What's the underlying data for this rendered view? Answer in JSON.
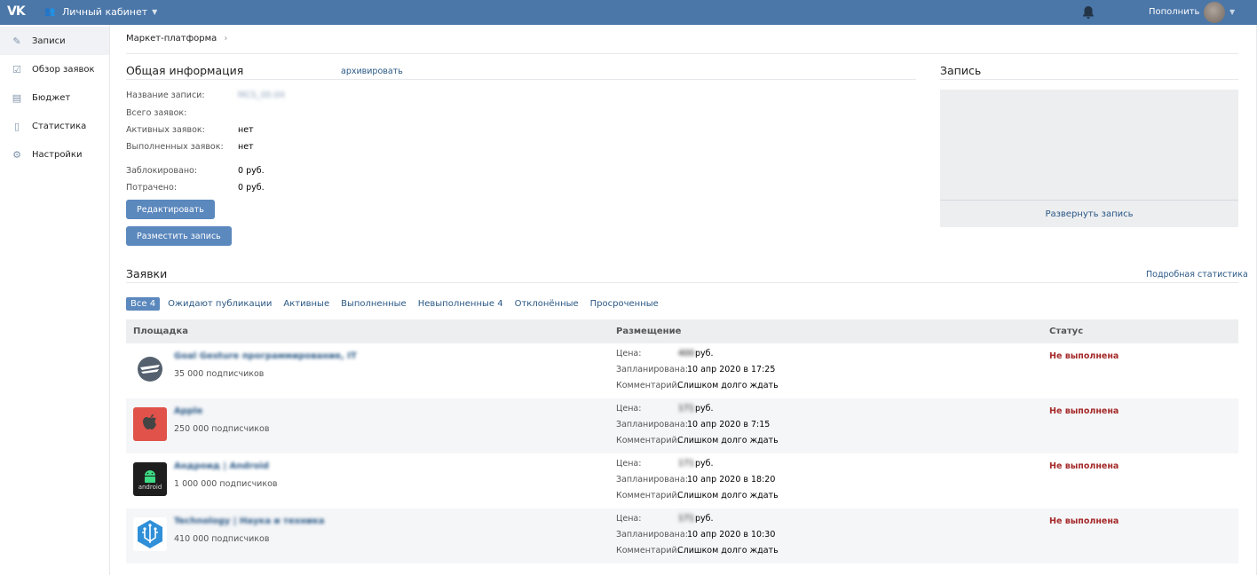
{
  "header": {
    "logo": "VK",
    "cabinet_label": "Личный кабинет",
    "topup_label": "Пополнить"
  },
  "sidebar": {
    "items": [
      {
        "label": "Записи",
        "icon": "megaphone-icon"
      },
      {
        "label": "Обзор заявок",
        "icon": "review-icon"
      },
      {
        "label": "Бюджет",
        "icon": "wallet-icon"
      },
      {
        "label": "Статистика",
        "icon": "stats-icon"
      },
      {
        "label": "Настройки",
        "icon": "gear-icon"
      }
    ]
  },
  "breadcrumb": {
    "label": "Маркет-платформа"
  },
  "general": {
    "title": "Общая информация",
    "archive_link": "архивировать",
    "fields": {
      "name_label": "Название записи:",
      "name_value": "MCS_00.04",
      "total_label": "Всего заявок:",
      "active_label": "Активных заявок:",
      "active_value": "нет",
      "done_label": "Выполненных заявок:",
      "done_value": "нет",
      "blocked_label": "Заблокировано:",
      "blocked_value": "0 руб.",
      "spent_label": "Потрачено:",
      "spent_value": "0 руб."
    },
    "edit_button": "Редактировать",
    "place_button": "Разместить запись"
  },
  "post": {
    "title": "Запись",
    "expand_link": "Развернуть запись"
  },
  "requests": {
    "title": "Заявки",
    "stats_link": "Подробная статистика",
    "tabs": [
      "Все 4",
      "Ожидают публикации",
      "Активные",
      "Выполненные",
      "Невыполненные 4",
      "Отклонённые",
      "Просроченные"
    ],
    "columns": {
      "site": "Площадка",
      "placement": "Размещение",
      "status": "Статус"
    },
    "placement_labels": {
      "price": "Цена:",
      "scheduled": "Запланирована:",
      "comment": "Комментарий:"
    },
    "rows": [
      {
        "name": "Goal Gesture программирование, IT",
        "subscribers": "35 000 подписчиков",
        "price": "400",
        "price_unit": "руб.",
        "scheduled": "10 апр 2020 в 17:25",
        "comment": "Слишком долго ждать",
        "status": "Не выполнена",
        "avatar_color": "#ffffff"
      },
      {
        "name": "Apple",
        "subscribers": "250 000 подписчиков",
        "price": "171",
        "price_unit": "руб.",
        "scheduled": "10 апр 2020 в 7:15",
        "comment": "Слишком долго ждать",
        "status": "Не выполнена",
        "avatar_color": "#e0524a"
      },
      {
        "name": "Андроид | Android",
        "subscribers": "1 000 000 подписчиков",
        "price": "171",
        "price_unit": "руб.",
        "scheduled": "10 апр 2020 в 18:20",
        "comment": "Слишком долго ждать",
        "status": "Не выполнена",
        "avatar_color": "#1e1e1e"
      },
      {
        "name": "Technology | Наука и техника",
        "subscribers": "410 000 подписчиков",
        "price": "171",
        "price_unit": "руб.",
        "scheduled": "10 апр 2020 в 10:30",
        "comment": "Слишком долго ждать",
        "status": "Не выполнена",
        "avatar_color": "#2f8fd8"
      }
    ]
  }
}
